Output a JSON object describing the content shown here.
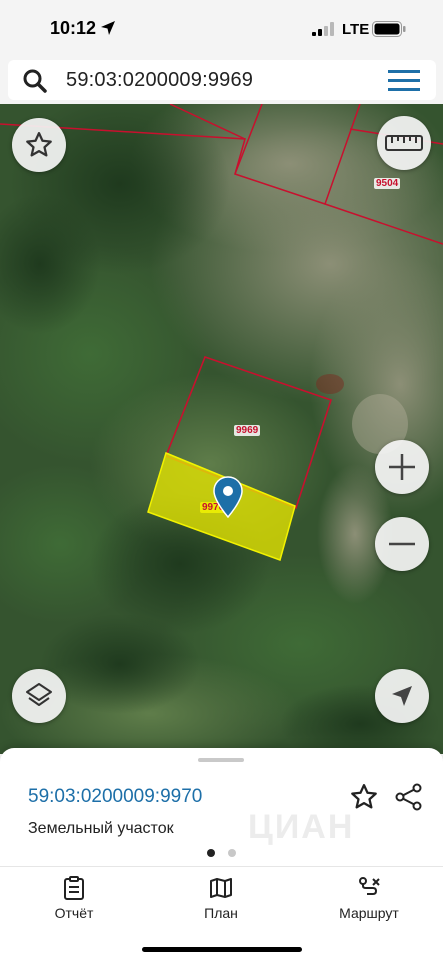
{
  "status_bar": {
    "time": "10:12",
    "network": "LTE"
  },
  "search": {
    "query": "59:03:0200009:9969"
  },
  "map": {
    "parcels": {
      "top_right": "9504",
      "main": "9969",
      "selected": "9970"
    },
    "selected_fill_color": "#e6e600",
    "boundary_color": "#c8102e"
  },
  "sheet": {
    "title": "59:03:0200009:9970",
    "subtitle": "Земельный участок",
    "active_page": 1,
    "page_count": 2
  },
  "tabs": [
    {
      "label": "Отчёт",
      "icon": "report-icon"
    },
    {
      "label": "План",
      "icon": "map-plan-icon"
    },
    {
      "label": "Маршрут",
      "icon": "route-icon"
    }
  ],
  "colors": {
    "accent": "#1d6fa8",
    "menu": "#1d6fa8"
  }
}
